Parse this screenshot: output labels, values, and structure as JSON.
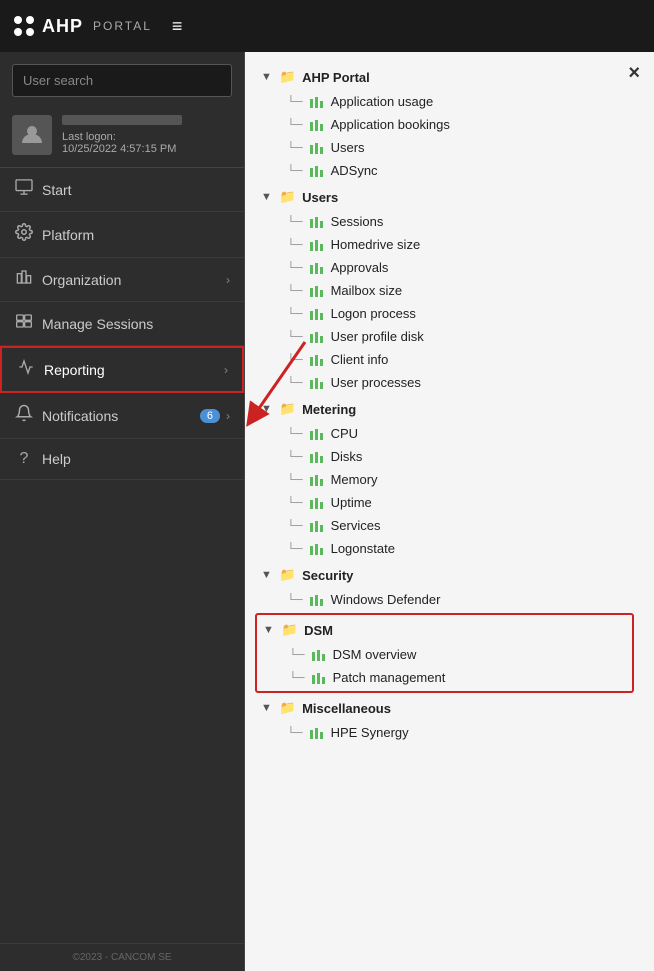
{
  "header": {
    "logo_dots": 4,
    "logo_text": "AHP",
    "logo_portal": "PORTAL",
    "menu_icon": "≡"
  },
  "sidebar": {
    "search_placeholder": "User search",
    "user": {
      "last_logon_label": "Last logon:",
      "last_logon_time": "10/25/2022 4:57:15 PM"
    },
    "nav_items": [
      {
        "id": "start",
        "label": "Start",
        "icon": "🖥",
        "has_chevron": false,
        "badge": null,
        "active": false
      },
      {
        "id": "platform",
        "label": "Platform",
        "icon": "⚙",
        "has_chevron": false,
        "badge": null,
        "active": false
      },
      {
        "id": "organization",
        "label": "Organization",
        "icon": "🏢",
        "has_chevron": true,
        "badge": null,
        "active": false
      },
      {
        "id": "manage-sessions",
        "label": "Manage Sessions",
        "icon": "⊞",
        "has_chevron": false,
        "badge": null,
        "active": false
      },
      {
        "id": "reporting",
        "label": "Reporting",
        "icon": "📈",
        "has_chevron": true,
        "badge": null,
        "active": true
      },
      {
        "id": "notifications",
        "label": "Notifications",
        "icon": "",
        "has_chevron": true,
        "badge": "6",
        "active": false
      },
      {
        "id": "help",
        "label": "Help",
        "icon": "?",
        "has_chevron": false,
        "badge": null,
        "active": false
      }
    ],
    "footer": "©2023 - CANCOM SE"
  },
  "dropdown": {
    "close_label": "×",
    "tree": [
      {
        "id": "ahp-portal",
        "label": "AHP Portal",
        "type": "folder",
        "children": [
          {
            "id": "application-usage",
            "label": "Application usage"
          },
          {
            "id": "application-bookings",
            "label": "Application bookings"
          },
          {
            "id": "users",
            "label": "Users"
          },
          {
            "id": "adsync",
            "label": "ADSync"
          }
        ]
      },
      {
        "id": "users",
        "label": "Users",
        "type": "folder",
        "children": [
          {
            "id": "sessions",
            "label": "Sessions"
          },
          {
            "id": "homedrive-size",
            "label": "Homedrive size"
          },
          {
            "id": "approvals",
            "label": "Approvals"
          },
          {
            "id": "mailbox-size",
            "label": "Mailbox size"
          },
          {
            "id": "logon-process",
            "label": "Logon process"
          },
          {
            "id": "user-profile-disk",
            "label": "User profile disk"
          },
          {
            "id": "client-info",
            "label": "Client info"
          },
          {
            "id": "user-processes",
            "label": "User processes"
          }
        ]
      },
      {
        "id": "metering",
        "label": "Metering",
        "type": "folder",
        "children": [
          {
            "id": "cpu",
            "label": "CPU"
          },
          {
            "id": "disks",
            "label": "Disks"
          },
          {
            "id": "memory",
            "label": "Memory"
          },
          {
            "id": "uptime",
            "label": "Uptime"
          },
          {
            "id": "services",
            "label": "Services"
          },
          {
            "id": "logonstate",
            "label": "Logonstate"
          }
        ]
      },
      {
        "id": "security",
        "label": "Security",
        "type": "folder",
        "children": [
          {
            "id": "windows-defender",
            "label": "Windows Defender"
          }
        ]
      },
      {
        "id": "dsm",
        "label": "DSM",
        "type": "folder",
        "highlight": true,
        "children": [
          {
            "id": "dsm-overview",
            "label": "DSM overview"
          },
          {
            "id": "patch-management",
            "label": "Patch management"
          }
        ]
      },
      {
        "id": "miscellaneous",
        "label": "Miscellaneous",
        "type": "folder",
        "children": [
          {
            "id": "hpe-synergy",
            "label": "HPE Synergy"
          }
        ]
      }
    ]
  }
}
